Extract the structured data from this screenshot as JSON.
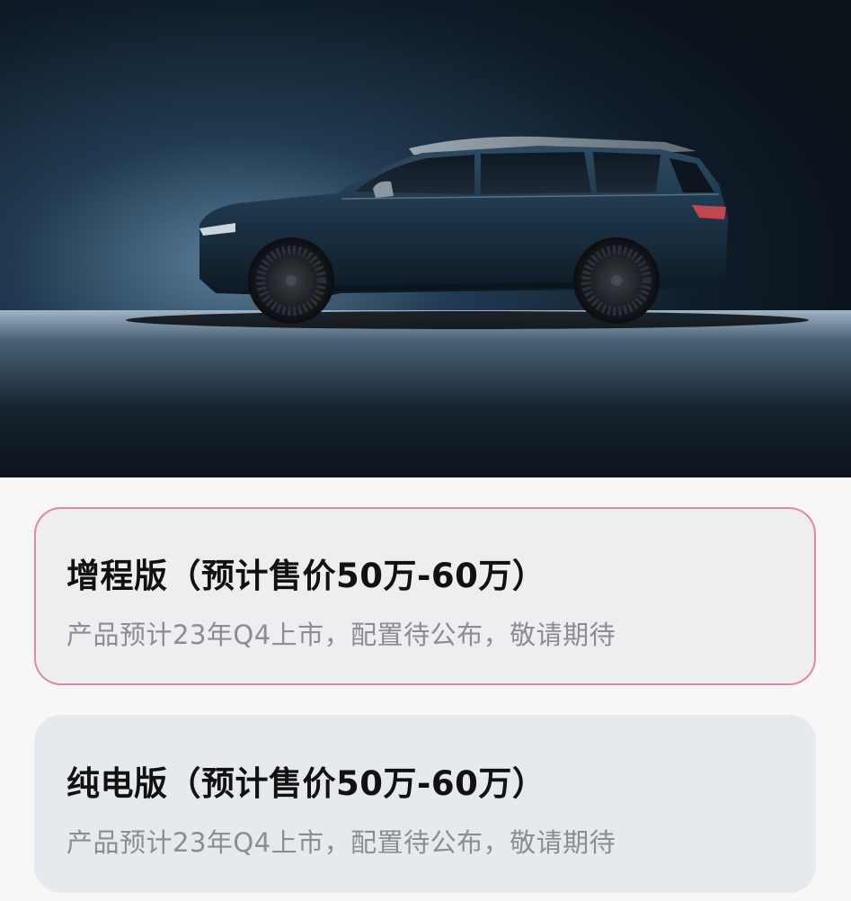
{
  "hero": {
    "image": "car-side-profile-image"
  },
  "options": [
    {
      "title": "增程版（预计售价50万-60万）",
      "description": "产品预计23年Q4上市，配置待公布，敬请期待",
      "selected": true
    },
    {
      "title": "纯电版（预计售价50万-60万）",
      "description": "产品预计23年Q4上市，配置待公布，敬请期待",
      "selected": false
    }
  ],
  "colors": {
    "selected_border": "#e08a9a",
    "selected_bg": "#eeedf0",
    "card_bg": "#e6e9ed",
    "title": "#111111",
    "description": "#8a8d92"
  }
}
